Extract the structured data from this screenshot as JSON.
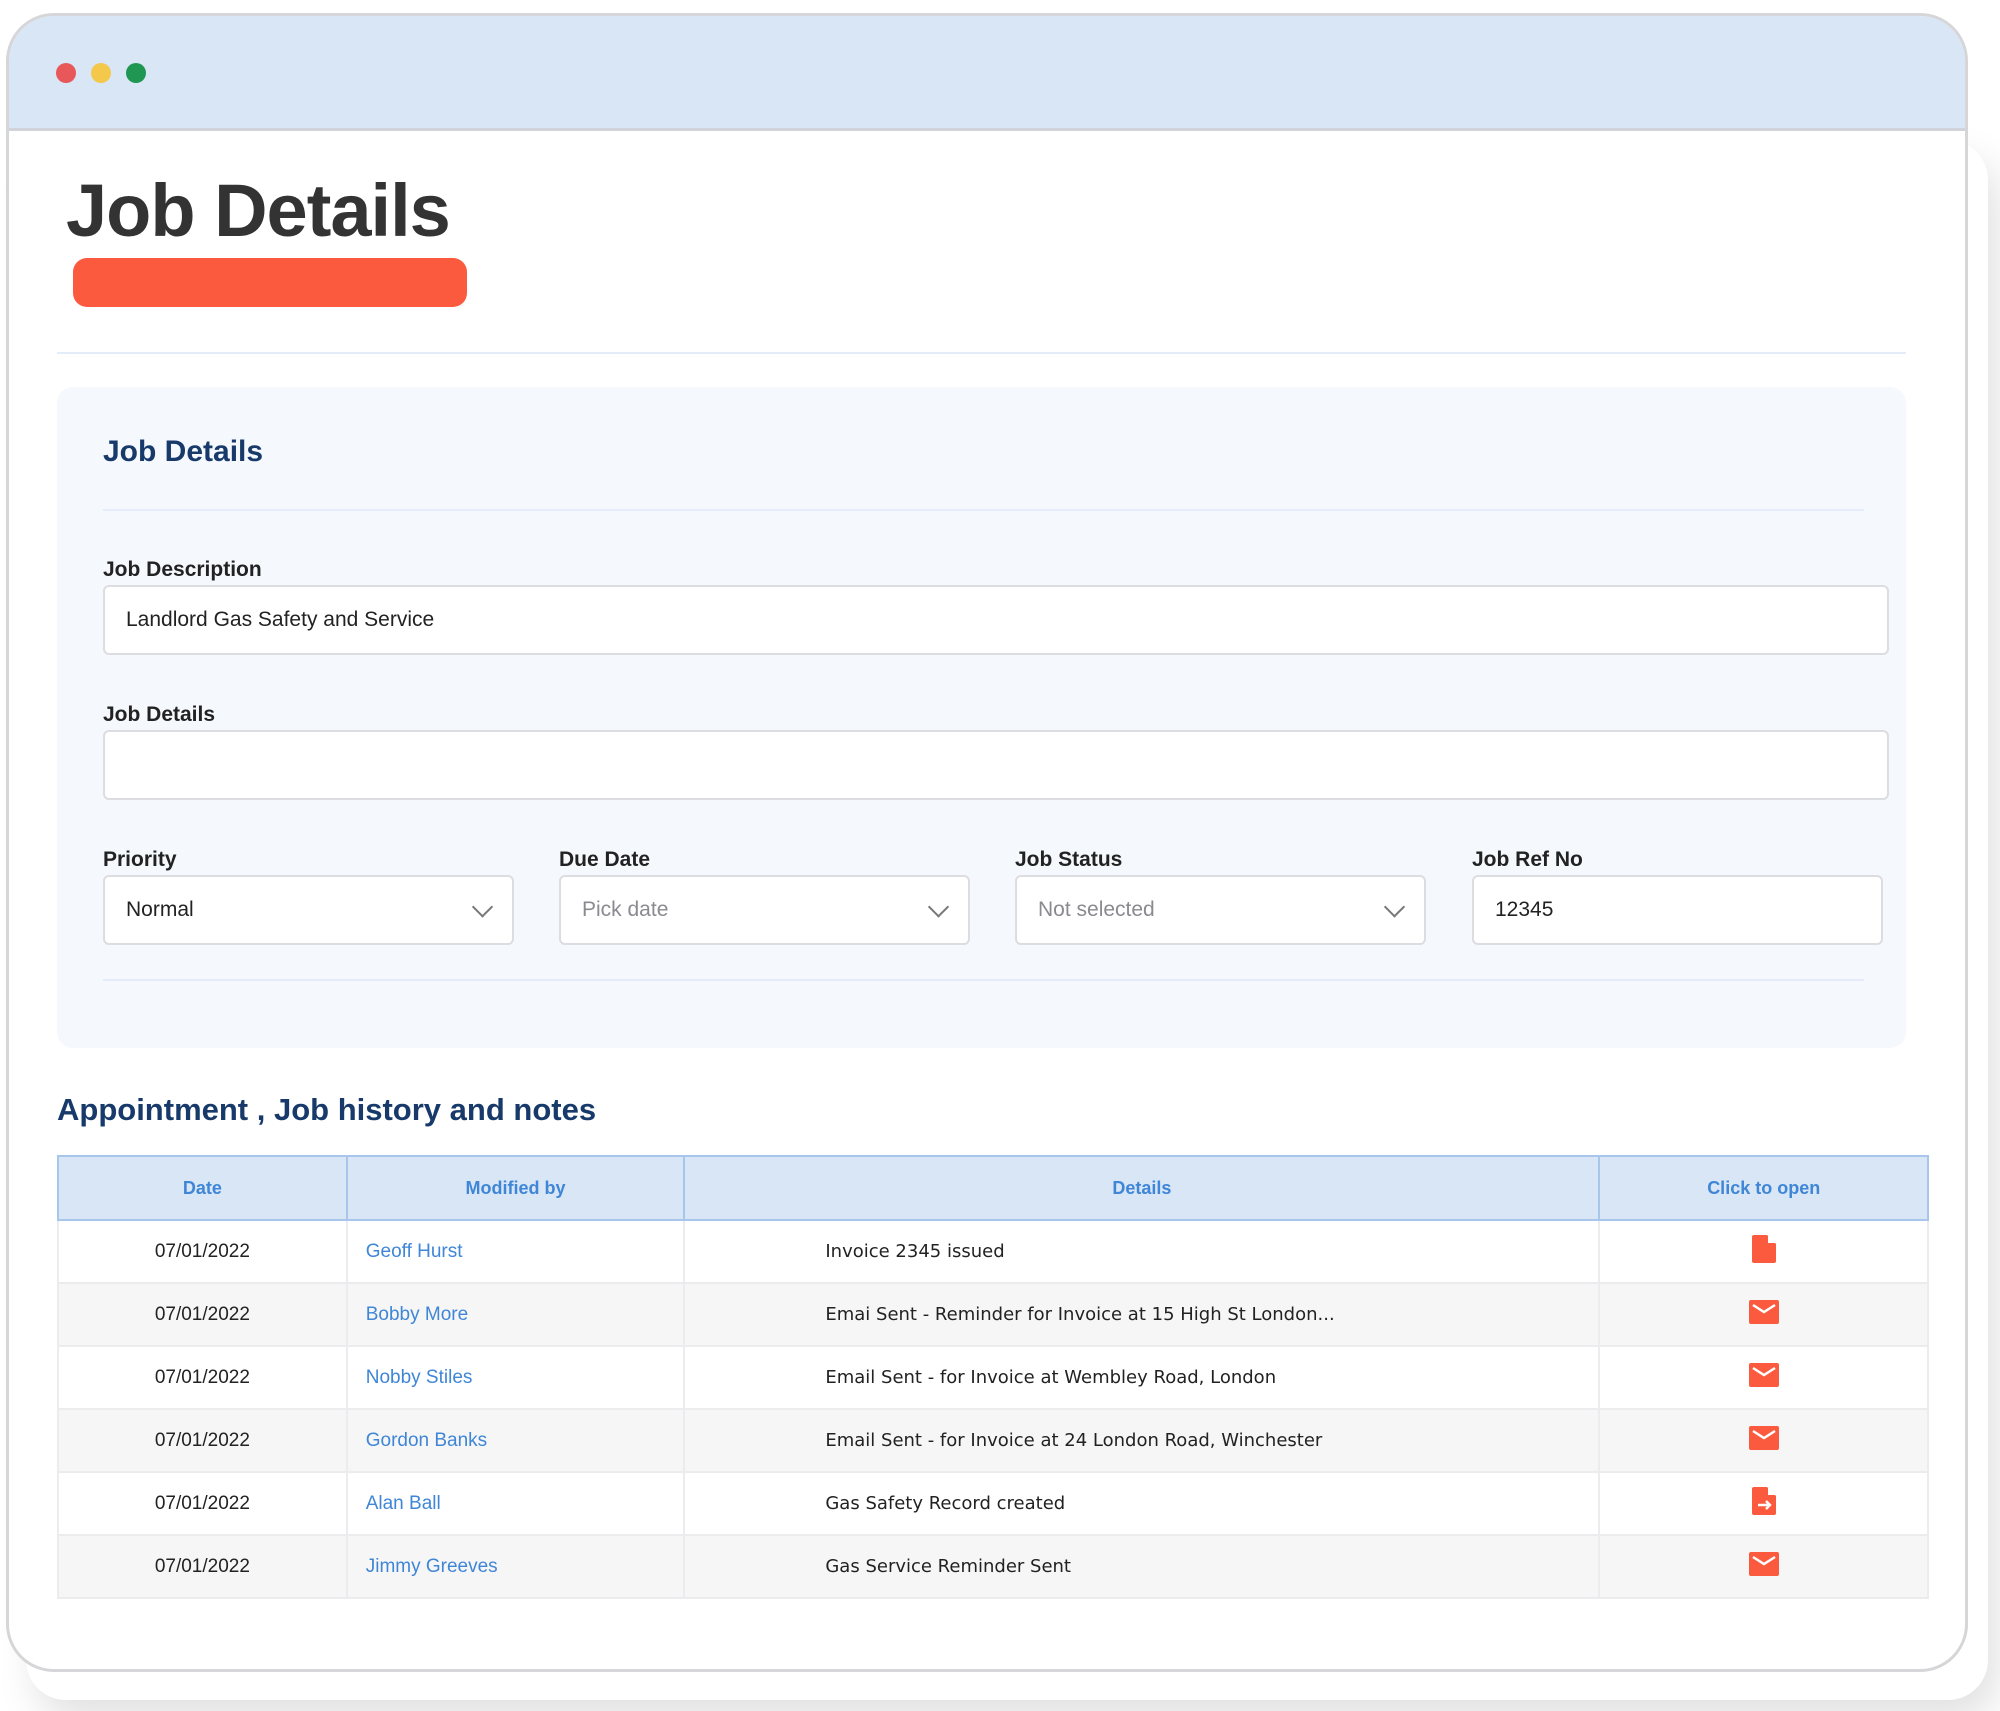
{
  "window": {
    "controls": [
      "close",
      "minimize",
      "maximize"
    ],
    "colors": {
      "close": "#e8585a",
      "minimize": "#f3c84b",
      "maximize": "#1f9652",
      "titlebar": "#d8e6f6"
    }
  },
  "header": {
    "title": "Job Details",
    "accent_color": "#fb5a3e"
  },
  "job_details_panel": {
    "heading": "Job Details",
    "job_description": {
      "label": "Job Description",
      "value": "Landlord Gas Safety and Service"
    },
    "job_details": {
      "label": "Job Details",
      "value": ""
    },
    "priority": {
      "label": "Priority",
      "value": "Normal",
      "icon": "chevron-down-icon"
    },
    "due_date": {
      "label": "Due Date",
      "placeholder": "Pick date",
      "icon": "chevron-down-icon"
    },
    "job_status": {
      "label": "Job Status",
      "placeholder": "Not selected",
      "icon": "chevron-down-icon"
    },
    "job_ref_no": {
      "label": "Job Ref No",
      "value": "12345"
    }
  },
  "history": {
    "heading": "Appointment , Job history and notes",
    "columns": [
      "Date",
      "Modified by",
      "Details",
      "Click to open"
    ],
    "rows": [
      {
        "date": "07/01/2022",
        "modified_by": "Geoff Hurst",
        "details": "Invoice 2345 issued",
        "icon": "document-icon"
      },
      {
        "date": "07/01/2022",
        "modified_by": "Bobby More",
        "details": "Emai Sent - Reminder for Invoice at 15 High St London...",
        "icon": "envelope-icon"
      },
      {
        "date": "07/01/2022",
        "modified_by": "Nobby Stiles",
        "details": "Email Sent - for Invoice at Wembley Road, London",
        "icon": "envelope-icon"
      },
      {
        "date": "07/01/2022",
        "modified_by": "Gordon Banks",
        "details": "Email Sent - for Invoice at 24 London Road, Winchester",
        "icon": "envelope-icon"
      },
      {
        "date": "07/01/2022",
        "modified_by": "Alan Ball",
        "details": "Gas Safety Record created",
        "icon": "document-export-icon"
      },
      {
        "date": "07/01/2022",
        "modified_by": "Jimmy Greeves",
        "details": "Gas Service Reminder Sent",
        "icon": "envelope-icon"
      }
    ],
    "colors": {
      "header_bg": "#d8e6f6",
      "header_text": "#3f86d6",
      "link": "#3f86d6",
      "icon": "#fb5a3e"
    }
  }
}
